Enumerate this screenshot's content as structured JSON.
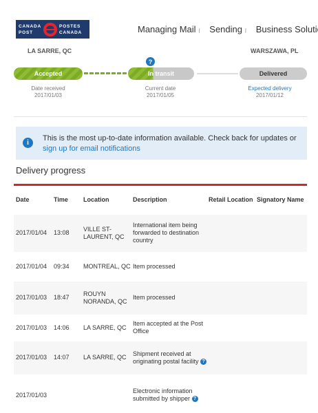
{
  "brand": {
    "line1_left": "CANADA",
    "line2_left": "POST",
    "line1_right": "POSTES",
    "line2_right": "CANADA",
    "colors": {
      "navy": "#1f3b6e",
      "red": "#e4262b"
    }
  },
  "nav": [
    "Managing Mail",
    "Sending",
    "Business Solutions"
  ],
  "route": {
    "from": "LA SARRE, QC",
    "to": "WARSZAWA, PL"
  },
  "stages": [
    {
      "label": "Accepted",
      "caption": "Date received",
      "date": "2017/01/03",
      "status": "done"
    },
    {
      "label": "In transit",
      "caption": "Current date",
      "date": "2017/01/05",
      "status": "current"
    },
    {
      "label": "Delivered",
      "caption": "Expected delivery",
      "date": "2017/01/12",
      "status": "pending"
    }
  ],
  "help_icon": "?",
  "banner": {
    "icon": "info-icon",
    "text": "This is the most up-to-date information available. Check back for updates or ",
    "link": "sign up for email notifications"
  },
  "section_title": "Delivery progress",
  "table": {
    "headers": [
      "Date",
      "Time",
      "Location",
      "Description",
      "Retail Location",
      "Signatory Name"
    ],
    "rows": [
      {
        "date": "2017/01/04",
        "time": "13:08",
        "location": "VILLE ST-LAURENT, QC",
        "description": "International item being forwarded to destination country",
        "help": false
      },
      {
        "date": "2017/01/04",
        "time": "09:34",
        "location": "MONTREAL, QC",
        "description": "Item processed",
        "help": false
      },
      {
        "date": "2017/01/03",
        "time": "18:47",
        "location": "ROUYN NORANDA, QC",
        "description": "Item processed",
        "help": false
      },
      {
        "date": "2017/01/03",
        "time": "14:06",
        "location": "LA SARRE, QC",
        "description": "Item accepted at the Post Office",
        "help": false
      },
      {
        "date": "2017/01/03",
        "time": "14:07",
        "location": "LA SARRE, QC",
        "description": "Shipment received at originating postal facility",
        "help": true
      },
      {
        "date": "2017/01/03",
        "time": "",
        "location": "",
        "description": "Electronic information submitted by shipper",
        "help": true
      }
    ]
  },
  "colors": {
    "accent_blue": "#1d78c1",
    "progress_green": "#7cab26",
    "table_rule_red": "#d0262d"
  }
}
